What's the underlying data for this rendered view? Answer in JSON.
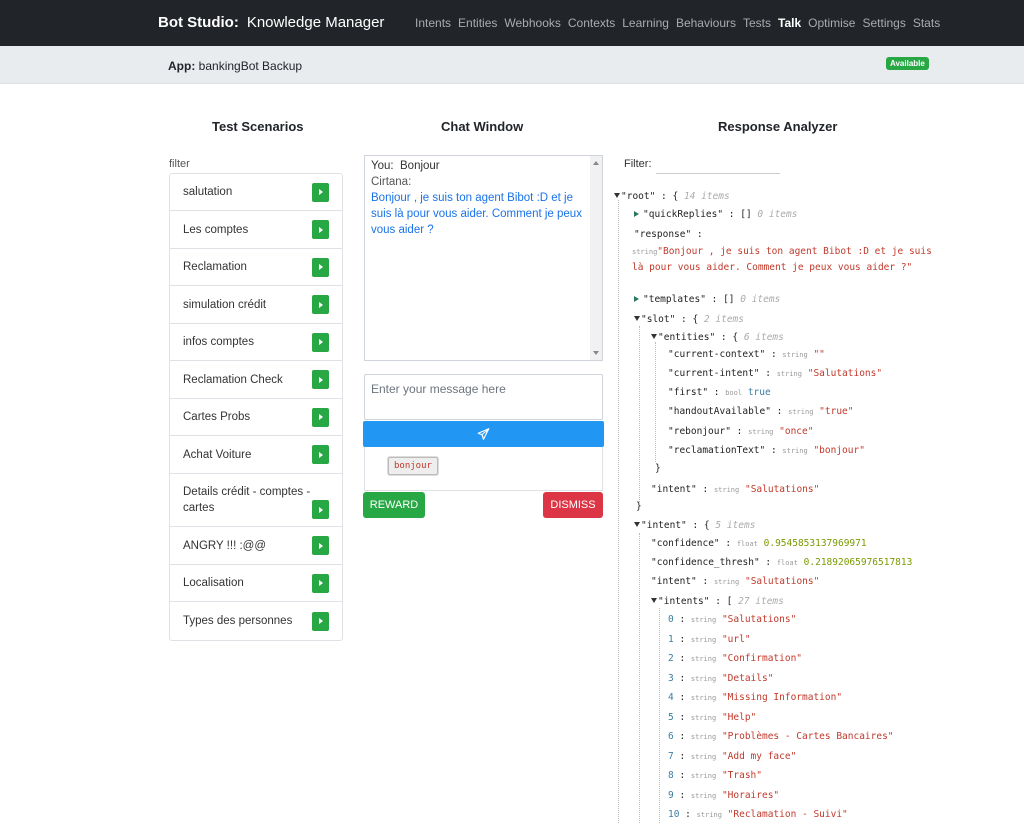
{
  "navbar": {
    "brand": "Bot Studio:",
    "subtitle": "Knowledge Manager",
    "items": [
      {
        "label": "Intents",
        "active": false
      },
      {
        "label": "Entities",
        "active": false
      },
      {
        "label": "Webhooks",
        "active": false
      },
      {
        "label": "Contexts",
        "active": false
      },
      {
        "label": "Learning",
        "active": false
      },
      {
        "label": "Behaviours",
        "active": false
      },
      {
        "label": "Tests",
        "active": false
      },
      {
        "label": "Talk",
        "active": true
      },
      {
        "label": "Optimise",
        "active": false
      },
      {
        "label": "Settings",
        "active": false
      },
      {
        "label": "Stats",
        "active": false
      }
    ]
  },
  "appbar": {
    "label": "App:",
    "name": "bankingBot Backup",
    "status": "Available",
    "status_color": "#28a745"
  },
  "scenarios": {
    "title": "Test Scenarios",
    "filter_label": "filter",
    "items": [
      "salutation",
      "Les comptes",
      "Reclamation",
      "simulation crédit",
      "infos comptes",
      "Reclamation Check",
      "Cartes Probs",
      "Achat Voiture",
      "Details crédit - comptes - cartes",
      "ANGRY !!! :@@",
      "Localisation",
      "Types des personnes"
    ]
  },
  "chat": {
    "title": "Chat Window",
    "user_label": "You:",
    "user_message": "Bonjour",
    "bot_name": "Cirtana:",
    "bot_message": "Bonjour , je suis ton agent Bibot :D et je suis là pour vous aider. Comment je peux vous aider ?",
    "input_placeholder": "Enter your message here",
    "send_icon": "paper-plane-icon",
    "quick_reply": "bonjour",
    "reward_label": "REWARD",
    "dismiss_label": "DISMISS"
  },
  "analyzer": {
    "title": "Response Analyzer",
    "filter_label": "Filter:",
    "tree": {
      "root": "\"root\"",
      "root_count": "14 items",
      "quickReplies": "\"quickReplies\"",
      "quickReplies_count": "0 items",
      "response_key": "\"response\"",
      "response_value": "\"Bonjour , je suis ton agent Bibot :D et je suis là pour vous aider. Comment je peux vous aider ?\"",
      "templates": "\"templates\"",
      "templates_count": "0 items",
      "slot": "\"slot\"",
      "slot_count": "2 items",
      "entities": "\"entities\"",
      "entities_count": "6 items",
      "entity_rows": [
        {
          "key": "\"current-context\"",
          "type": "string",
          "value": "\"\""
        },
        {
          "key": "\"current-intent\"",
          "type": "string",
          "value": "\"Salutations\""
        },
        {
          "key": "\"first\"",
          "type": "bool",
          "value": "true"
        },
        {
          "key": "\"handoutAvailable\"",
          "type": "string",
          "value": "\"true\""
        },
        {
          "key": "\"rebonjour\"",
          "type": "string",
          "value": "\"once\""
        },
        {
          "key": "\"reclamationText\"",
          "type": "string",
          "value": "\"bonjour\""
        }
      ],
      "slot_intent_key": "\"intent\"",
      "slot_intent_value": "\"Salutations\"",
      "intent": "\"intent\"",
      "intent_count": "5 items",
      "confidence_key": "\"confidence\"",
      "confidence_value": "0.9545853137969971",
      "confidence_thresh_key": "\"confidence_thresh\"",
      "confidence_thresh_value": "0.21892065976517813",
      "intent_intent_key": "\"intent\"",
      "intent_intent_value": "\"Salutations\"",
      "intents": "\"intents\"",
      "intents_count": "27 items",
      "intents_list": [
        "\"Salutations\"",
        "\"url\"",
        "\"Confirmation\"",
        "\"Details\"",
        "\"Missing Information\"",
        "\"Help\"",
        "\"Problèmes - Cartes Bancaires\"",
        "\"Add my face\"",
        "\"Trash\"",
        "\"Horaires\"",
        "\"Reclamation - Suivi\""
      ]
    }
  }
}
